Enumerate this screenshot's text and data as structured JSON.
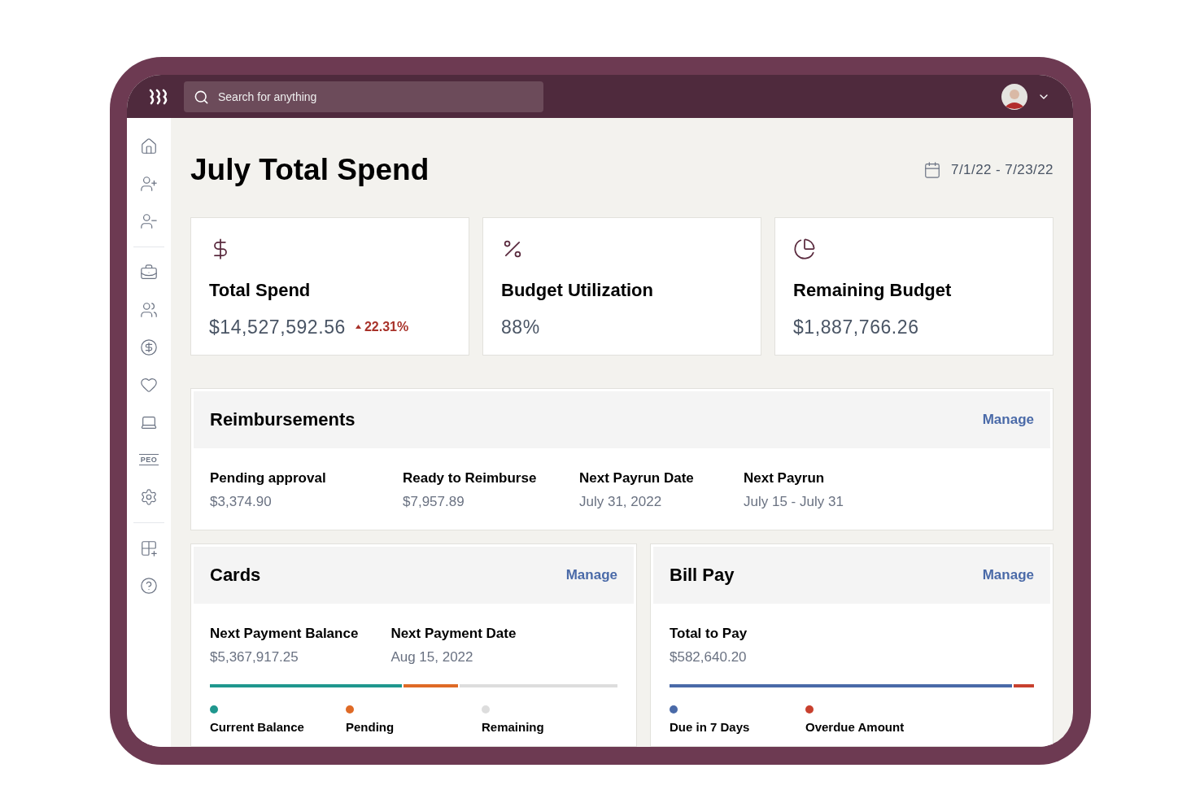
{
  "topbar": {
    "search": {
      "placeholder": "Search for anything"
    }
  },
  "sidebar": {
    "groups": [
      [
        {
          "kind": "home"
        },
        {
          "kind": "adduser"
        },
        {
          "kind": "removeuser"
        }
      ],
      [
        {
          "kind": "toolbox"
        },
        {
          "kind": "people"
        },
        {
          "kind": "money"
        },
        {
          "kind": "heart"
        },
        {
          "kind": "laptop"
        },
        {
          "kind": "peo",
          "label": "PEO"
        },
        {
          "kind": "settings"
        }
      ],
      [
        {
          "kind": "apps"
        },
        {
          "kind": "help"
        }
      ]
    ]
  },
  "page": {
    "title": "July Total Spend",
    "date_range": "7/1/22 - 7/23/22"
  },
  "stats": [
    {
      "kind": "dollar",
      "label": "Total Spend",
      "value": "$14,527,592.56",
      "change": "22.31%"
    },
    {
      "kind": "percent",
      "label": "Budget Utilization",
      "value": "88%"
    },
    {
      "kind": "pie",
      "label": "Remaining Budget",
      "value": "$1,887,766.26"
    }
  ],
  "reimbursements": {
    "title": "Reimbursements",
    "action": "Manage",
    "fields": [
      {
        "label": "Pending approval",
        "value": "$3,374.90"
      },
      {
        "label": "Ready to Reimburse",
        "value": "$7,957.89"
      },
      {
        "label": "Next Payrun Date",
        "value": "July 31, 2022"
      },
      {
        "label": "Next Payrun",
        "value": "July 15 - July 31"
      }
    ]
  },
  "panels": [
    {
      "title": "Cards",
      "action": "Manage",
      "fields": [
        {
          "label": "Next Payment Balance",
          "value": "$5,367,917.25"
        },
        {
          "label": "Next Payment Date",
          "value": "Aug 15, 2022"
        }
      ],
      "bar": {
        "color": "#dddddd",
        "fills": [
          {
            "level": 0.612,
            "color": "#df6a26"
          },
          {
            "level": 0.475,
            "color": "#1f978e"
          }
        ]
      },
      "legend": [
        {
          "label": "Current Balance",
          "color": "#1f978e"
        },
        {
          "label": "Pending",
          "color": "#df6a26"
        },
        {
          "label": "Remaining",
          "color": "#dddddd"
        }
      ]
    },
    {
      "title": "Bill Pay",
      "action": "Manage",
      "fields": [
        {
          "label": "Total to Pay",
          "value": "$582,640.20"
        }
      ],
      "bar": {
        "color": "#c8402e",
        "fills": [
          {
            "level": 0.945,
            "color": "#4a6aa8"
          }
        ]
      },
      "legend": [
        {
          "label": "Due in 7 Days",
          "color": "#4a6aa8"
        },
        {
          "label": "Overdue Amount",
          "color": "#c8402e"
        }
      ]
    }
  ]
}
